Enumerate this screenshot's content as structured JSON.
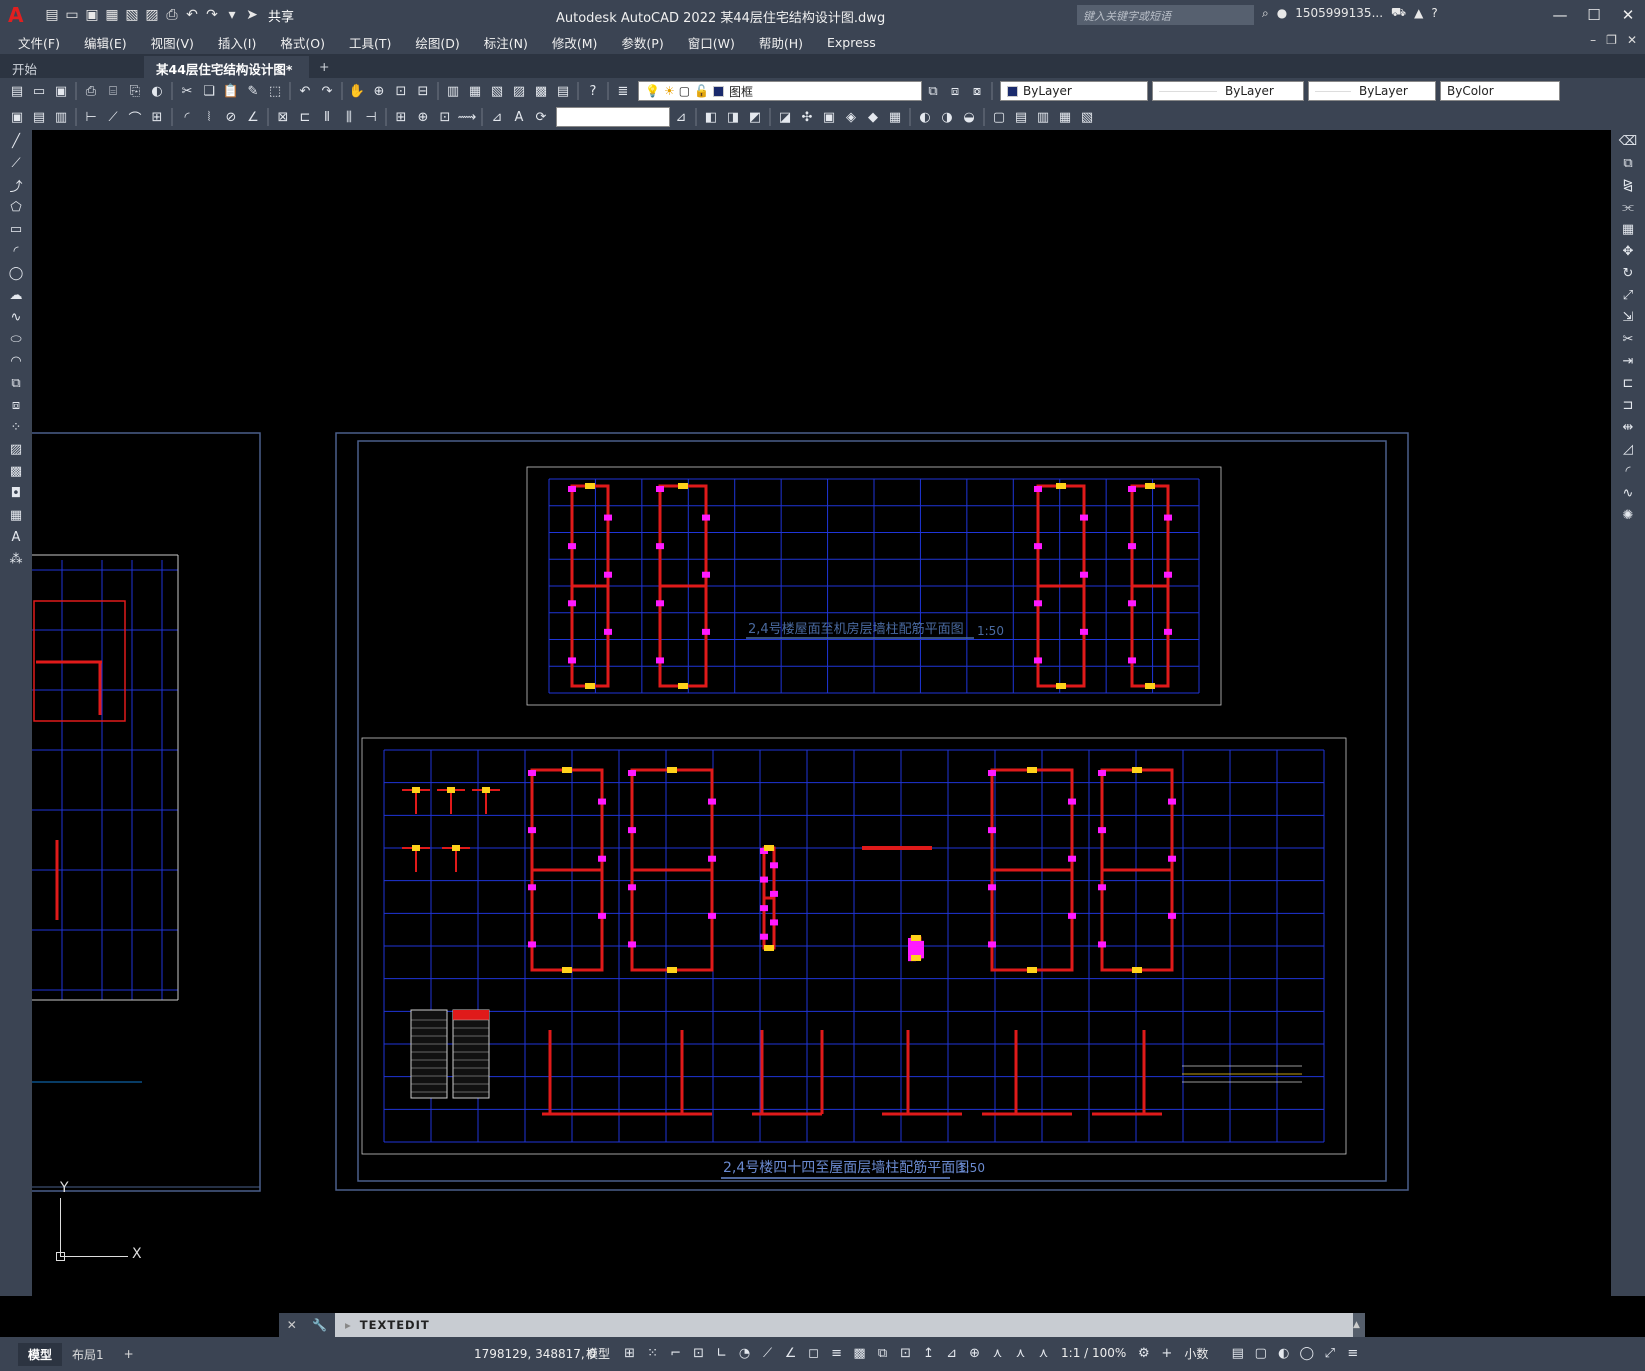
{
  "titlebar": {
    "app_letter": "A",
    "title": "Autodesk AutoCAD 2022    某44层住宅结构设计图.dwg",
    "share_label": "共享",
    "search_placeholder": "键入关键字或短语",
    "user": "1505999135...",
    "help": "?"
  },
  "menu": [
    "文件(F)",
    "编辑(E)",
    "视图(V)",
    "插入(I)",
    "格式(O)",
    "工具(T)",
    "绘图(D)",
    "标注(N)",
    "修改(M)",
    "参数(P)",
    "窗口(W)",
    "帮助(H)",
    "Express"
  ],
  "tabs": {
    "start": "开始",
    "doc": "某44层住宅结构设计图*",
    "close": "✕",
    "plus": "+"
  },
  "toolbar": {
    "layer": "图框",
    "color": "ByLayer",
    "linetype": "ByLayer",
    "lineweight": "ByLayer",
    "plotstyle": "ByColor"
  },
  "drawing": {
    "title_top": "2,4号楼屋面至机房层墙柱配筋平面图",
    "scale_top": "1:50",
    "title_bottom": "2,4号楼四十四至屋面层墙柱配筋平面图",
    "scale_bottom": "1:50",
    "ucs_y": "Y",
    "ucs_x": "X"
  },
  "colors": {
    "frame": "#4a5f8a",
    "grid": "#1f35d8",
    "wall": "#e01a1a",
    "rebar": "#ff1aff",
    "column": "#ffd21a",
    "dim": "#c8c8c8"
  },
  "command": {
    "text": "TEXTEDIT"
  },
  "status": {
    "model_tab": "模型",
    "layout_tab": "布局1",
    "add_tab": "+",
    "coords": "1798129, 348817, 0",
    "model": "模型",
    "scale": "1:1 / 100%",
    "units": "小数"
  }
}
